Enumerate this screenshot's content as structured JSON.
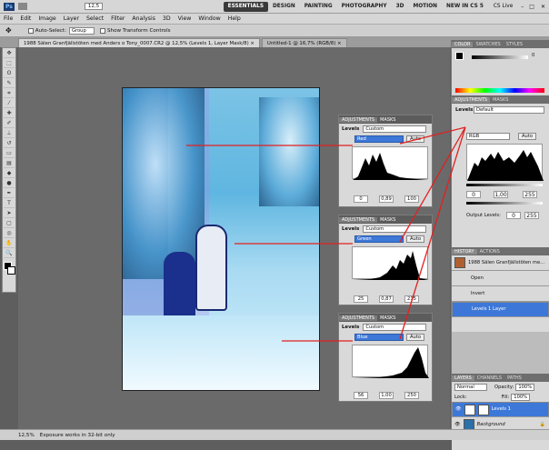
{
  "menu": [
    "File",
    "Edit",
    "Image",
    "Layer",
    "Select",
    "Filter",
    "Analysis",
    "3D",
    "View",
    "Window",
    "Help"
  ],
  "zoom_field": "12,5",
  "workspaces": [
    "ESSENTIALS",
    "DESIGN",
    "PAINTING",
    "PHOTOGRAPHY",
    "3D",
    "MOTION",
    "NEW IN CS 5"
  ],
  "cs_live": "CS Live",
  "options": {
    "auto_select": "Auto-Select:",
    "group": "Group",
    "transform": "Show Transform Controls"
  },
  "tabs": [
    "1988 Sälen Granfjällstöten med Anders o Tony_0007.CR2 @ 12,5% (Levels 1, Layer Mask/8) ×",
    "Untitled-1 @ 16,7% (RGB/8) ×"
  ],
  "status": {
    "zoom": "12,5%",
    "message": "Exposure works in 32-bit only"
  },
  "adj_panels": [
    {
      "tab1": "ADJUSTMENTS",
      "tab2": "MASKS",
      "label": "Levels",
      "preset": "Custom",
      "channel": "Red",
      "auto": "Auto",
      "values": [
        "0",
        "0,89",
        "100"
      ]
    },
    {
      "tab1": "ADJUSTMENTS",
      "tab2": "MASKS",
      "label": "Levels",
      "preset": "Custom",
      "channel": "Green",
      "auto": "Auto",
      "values": [
        "25",
        "0,87",
        "215"
      ]
    },
    {
      "tab1": "ADJUSTMENTS",
      "tab2": "MASKS",
      "label": "Levels",
      "preset": "Custom",
      "channel": "Blue",
      "auto": "Auto",
      "values": [
        "56",
        "1,00",
        "250"
      ]
    }
  ],
  "right": {
    "color_tabs": [
      "COLOR",
      "SWATCHES",
      "STYLES"
    ],
    "color_value": "0",
    "adj_tabs": [
      "ADJUSTMENTS",
      "MASKS"
    ],
    "levels_label": "Levels",
    "levels_preset": "Default",
    "channel": "RGB",
    "auto": "Auto",
    "input": [
      "0",
      "1,00",
      "255"
    ],
    "output_label": "Output Levels:",
    "output": [
      "0",
      "255"
    ],
    "history_tabs": [
      "HISTORY",
      "ACTIONS"
    ],
    "history_doc": "1988 Sälen Granfjällstöten me...",
    "history": [
      "Open",
      "Invert",
      "Levels 1 Layer"
    ],
    "layer_tabs": [
      "LAYERS",
      "CHANNELS",
      "PATHS"
    ],
    "blend": "Normal",
    "opacity_label": "Opacity:",
    "opacity": "100%",
    "lock_label": "Lock:",
    "fill_label": "Fill:",
    "fill": "100%",
    "layers": [
      "Levels 1",
      "Background"
    ]
  }
}
